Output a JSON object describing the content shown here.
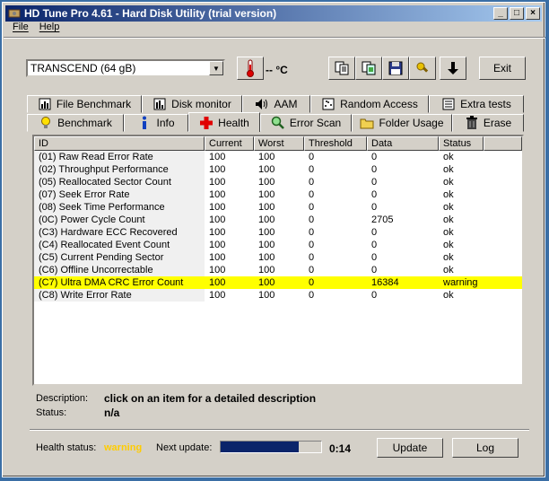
{
  "window": {
    "title": "HD Tune Pro 4.61 - Hard Disk Utility (trial version)",
    "controls": [
      "_",
      "□",
      "×"
    ]
  },
  "menu": [
    {
      "label": "File",
      "underline": "F"
    },
    {
      "label": "Help",
      "underline": "H"
    }
  ],
  "toolbar": {
    "drive": "TRANSCEND (64 gB)",
    "temperature": "-- °C",
    "exit_label": "Exit"
  },
  "tabs_top": [
    {
      "label": "File Benchmark",
      "icon": "file-benchmark-icon"
    },
    {
      "label": "Disk monitor",
      "icon": "disk-monitor-icon"
    },
    {
      "label": "AAM",
      "icon": "speaker-icon"
    },
    {
      "label": "Random Access",
      "icon": "random-access-icon"
    },
    {
      "label": "Extra tests",
      "icon": "extra-tests-icon"
    }
  ],
  "tabs_bottom": [
    {
      "label": "Benchmark",
      "icon": "lightbulb-icon"
    },
    {
      "label": "Info",
      "icon": "info-icon"
    },
    {
      "label": "Health",
      "icon": "health-cross-icon",
      "active": true
    },
    {
      "label": "Error Scan",
      "icon": "magnifier-icon"
    },
    {
      "label": "Folder Usage",
      "icon": "folder-icon"
    },
    {
      "label": "Erase",
      "icon": "trash-icon"
    }
  ],
  "table": {
    "headers": [
      "ID",
      "Current",
      "Worst",
      "Threshold",
      "Data",
      "Status"
    ],
    "rows": [
      [
        "(01) Raw Read Error Rate",
        "100",
        "100",
        "0",
        "0",
        "ok"
      ],
      [
        "(02) Throughput Performance",
        "100",
        "100",
        "0",
        "0",
        "ok"
      ],
      [
        "(05) Reallocated Sector Count",
        "100",
        "100",
        "0",
        "0",
        "ok"
      ],
      [
        "(07) Seek Error Rate",
        "100",
        "100",
        "0",
        "0",
        "ok"
      ],
      [
        "(08) Seek Time Performance",
        "100",
        "100",
        "0",
        "0",
        "ok"
      ],
      [
        "(0C) Power Cycle Count",
        "100",
        "100",
        "0",
        "2705",
        "ok"
      ],
      [
        "(C3) Hardware ECC Recovered",
        "100",
        "100",
        "0",
        "0",
        "ok"
      ],
      [
        "(C4) Reallocated Event Count",
        "100",
        "100",
        "0",
        "0",
        "ok"
      ],
      [
        "(C5) Current Pending Sector",
        "100",
        "100",
        "0",
        "0",
        "ok"
      ],
      [
        "(C6) Offline Uncorrectable",
        "100",
        "100",
        "0",
        "0",
        "ok"
      ],
      [
        "(C7) Ultra DMA CRC Error Count",
        "100",
        "100",
        "0",
        "16384",
        "warning"
      ],
      [
        "(C8) Write Error Rate",
        "100",
        "100",
        "0",
        "0",
        "ok"
      ]
    ],
    "highlight_color": "#ffff00"
  },
  "details": {
    "description_label": "Description:",
    "description_value": "click on an item for a detailed description",
    "status_label": "Status:",
    "status_value": "n/a"
  },
  "status": {
    "health_label": "Health status:",
    "health_value": "warning",
    "health_color": "#ffcc00",
    "next_update_label": "Next update:",
    "progress": 0.78,
    "timer": "0:14",
    "update_label": "Update",
    "log_label": "Log"
  }
}
